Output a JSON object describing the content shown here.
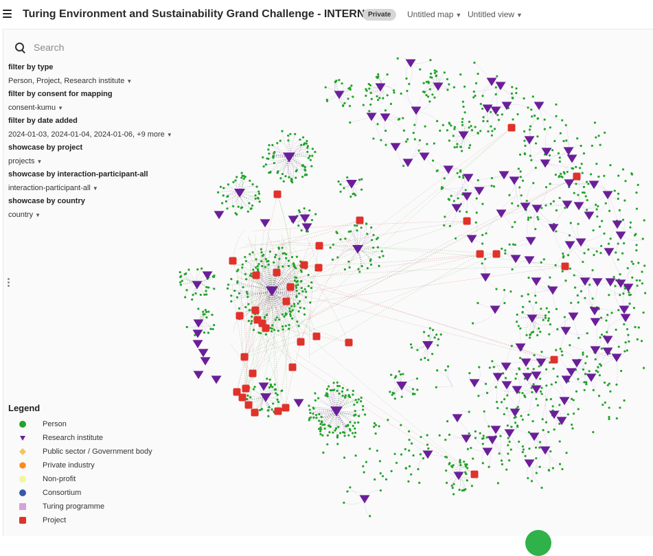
{
  "header": {
    "title": "Turing Environment and Sustainability Grand Challenge - INTERNAL",
    "badge": "Private",
    "map_selector": "Untitled map",
    "view_selector": "Untitled view"
  },
  "search": {
    "placeholder": "Search"
  },
  "filters": [
    {
      "title": "filter by type",
      "value": "Person, Project, Research institute"
    },
    {
      "title": "filter by consent for mapping",
      "value": "consent-kumu"
    },
    {
      "title": "filter by date added",
      "value": "2024-01-03, 2024-01-04, 2024-01-06, +9 more"
    },
    {
      "title": "showcase by project",
      "value": "projects"
    },
    {
      "title": "showcase by interaction-participant-all",
      "value": "interaction-participant-all"
    },
    {
      "title": "showcase by country",
      "value": "country"
    }
  ],
  "legend": {
    "title": "Legend",
    "items": [
      {
        "label": "Person",
        "shape": "circle",
        "color": "#22a32a"
      },
      {
        "label": "Research institute",
        "shape": "triangle",
        "color": "#6a1f99"
      },
      {
        "label": "Public sector / Government body",
        "shape": "diamond",
        "color": "#f3c45c"
      },
      {
        "label": "Private industry",
        "shape": "hexagon",
        "color": "#f68b1f"
      },
      {
        "label": "Non-profit",
        "shape": "circle",
        "color": "#f2f59a"
      },
      {
        "label": "Consortium",
        "shape": "circle",
        "color": "#3a5aa6"
      },
      {
        "label": "Turing programme",
        "shape": "square",
        "color": "#d4a3d9"
      },
      {
        "label": "Project",
        "shape": "rounded-square",
        "color": "#e0322a"
      }
    ]
  },
  "colors": {
    "person": "#22a32a",
    "research_institute": "#6a1f99",
    "project": "#e0322a",
    "accent": "#2fb24a"
  }
}
